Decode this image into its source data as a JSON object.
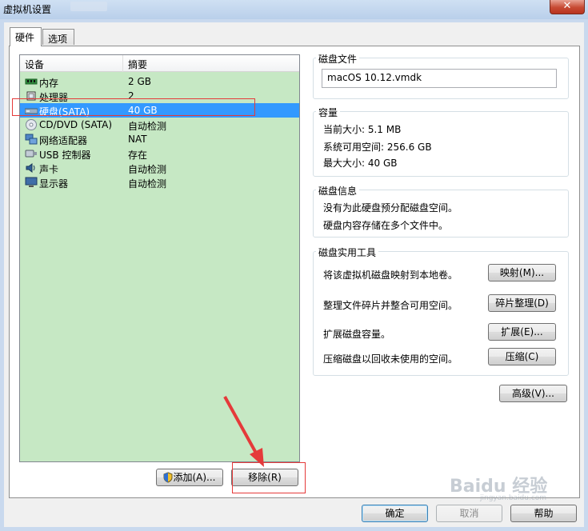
{
  "window": {
    "title": "虚拟机设置",
    "close_label": "✕"
  },
  "tabs": [
    {
      "label": "硬件",
      "active": true
    },
    {
      "label": "选项",
      "active": false
    }
  ],
  "device_list": {
    "columns": [
      "设备",
      "摘要"
    ],
    "rows": [
      {
        "name": "内存",
        "summary": "2 GB",
        "icon": "memory-icon",
        "selected": false
      },
      {
        "name": "处理器",
        "summary": "2",
        "icon": "processor-icon",
        "selected": false
      },
      {
        "name": "硬盘(SATA)",
        "summary": "40 GB",
        "icon": "hard-disk-icon",
        "selected": true
      },
      {
        "name": "CD/DVD (SATA)",
        "summary": "自动检测",
        "icon": "cd-dvd-icon",
        "selected": false
      },
      {
        "name": "网络适配器",
        "summary": "NAT",
        "icon": "network-adapter-icon",
        "selected": false
      },
      {
        "name": "USB 控制器",
        "summary": "存在",
        "icon": "usb-icon",
        "selected": false
      },
      {
        "name": "声卡",
        "summary": "自动检测",
        "icon": "sound-card-icon",
        "selected": false
      },
      {
        "name": "显示器",
        "summary": "自动检测",
        "icon": "display-icon",
        "selected": false
      }
    ]
  },
  "list_buttons": {
    "add": "添加(A)...",
    "remove": "移除(R)"
  },
  "disk_file": {
    "title": "磁盘文件",
    "value": "macOS 10.12.vmdk"
  },
  "capacity": {
    "title": "容量",
    "current_size": "当前大小: 5.1 MB",
    "free_space": "系统可用空间: 256.6 GB",
    "max_size": "最大大小: 40 GB"
  },
  "disk_info": {
    "title": "磁盘信息",
    "line1": "没有为此硬盘预分配磁盘空间。",
    "line2": "硬盘内容存储在多个文件中。"
  },
  "disk_utilities": {
    "title": "磁盘实用工具",
    "rows": [
      {
        "description": "将该虚拟机磁盘映射到本地卷。",
        "button": "映射(M)..."
      },
      {
        "description": "整理文件碎片并整合可用空间。",
        "button": "碎片整理(D)"
      },
      {
        "description": "扩展磁盘容量。",
        "button": "扩展(E)..."
      },
      {
        "description": "压缩磁盘以回收未使用的空间。",
        "button": "压缩(C)"
      }
    ]
  },
  "advanced_button": "高级(V)...",
  "footer": {
    "ok": "确定",
    "cancel": "取消",
    "help": "帮助"
  },
  "watermark": {
    "text": "Baidu 经验",
    "sub": "jingyan.baidu.com"
  },
  "colors": {
    "list_bg": "#c6e8c4",
    "selection": "#3399ff",
    "annotation": "#e53a3a"
  }
}
